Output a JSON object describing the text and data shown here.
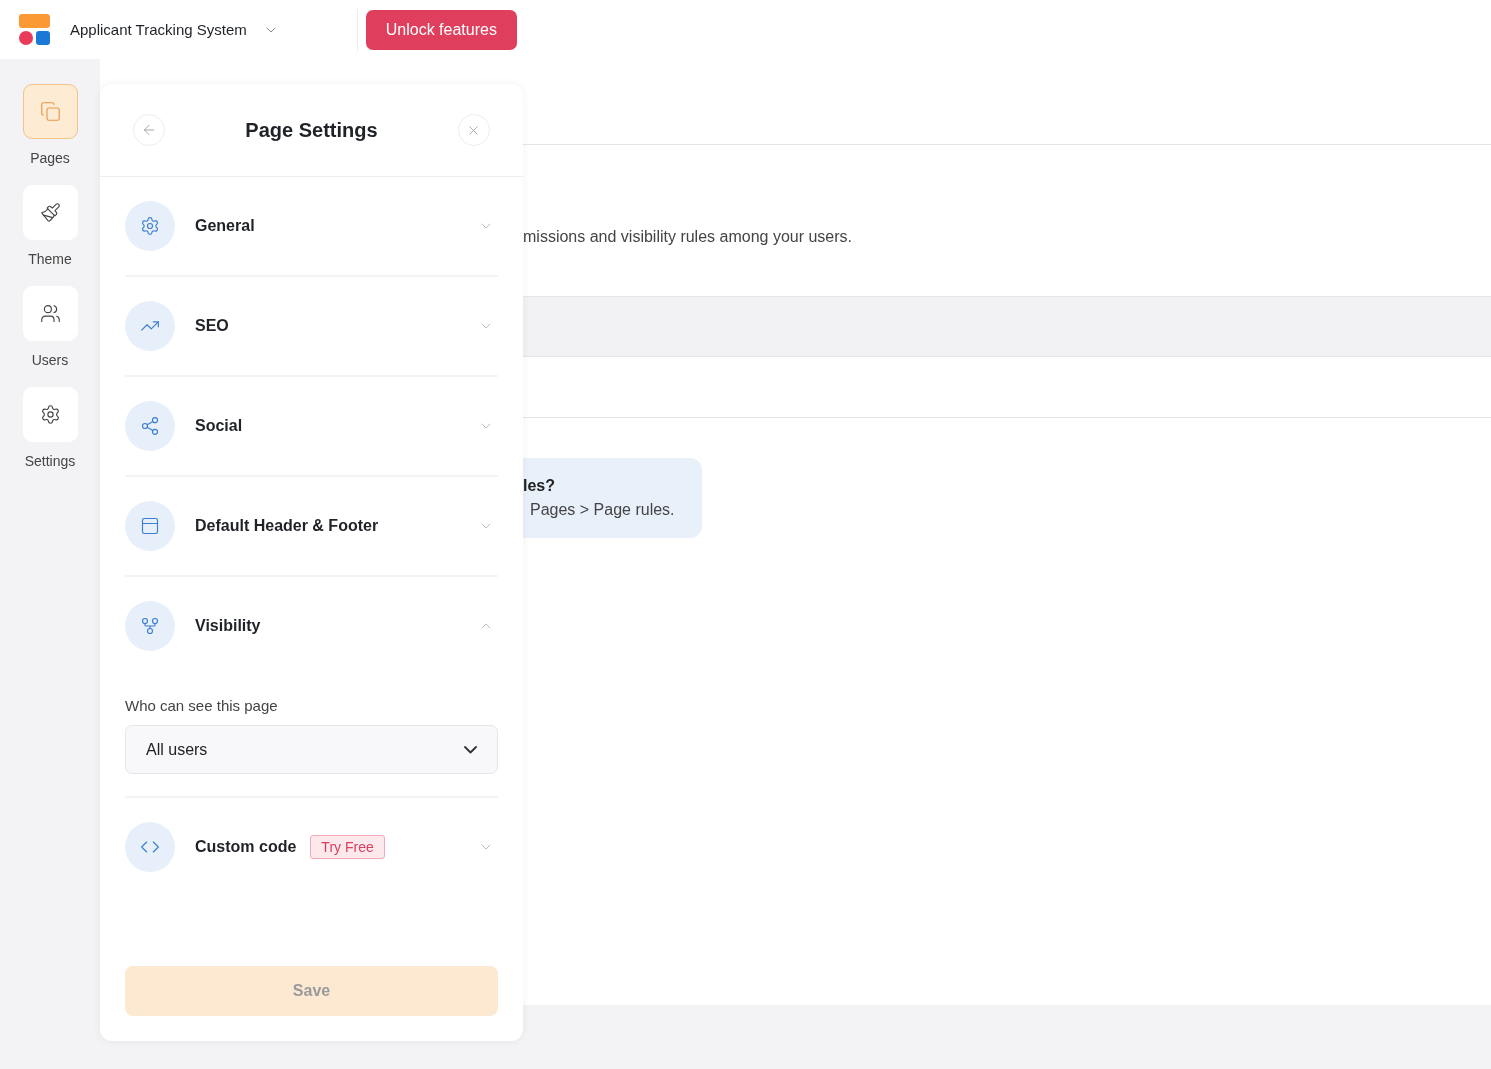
{
  "topbar": {
    "app_name": "Applicant Tracking System",
    "cta": "Unlock features"
  },
  "nav": [
    {
      "label": "Pages",
      "selected": true
    },
    {
      "label": "Theme",
      "selected": false
    },
    {
      "label": "Users",
      "selected": false
    },
    {
      "label": "Settings",
      "selected": false
    }
  ],
  "panel": {
    "title": "Page Settings",
    "sections": [
      {
        "title": "General",
        "expanded": false
      },
      {
        "title": "SEO",
        "expanded": false
      },
      {
        "title": "Social",
        "expanded": false
      },
      {
        "title": "Default Header & Footer",
        "expanded": false
      },
      {
        "title": "Visibility",
        "expanded": true,
        "field": {
          "label": "Who can see this page",
          "value": "All users"
        }
      },
      {
        "title": "Custom code",
        "expanded": false,
        "badge": "Try Free"
      }
    ],
    "save": {
      "label": "Save",
      "disabled": true
    }
  },
  "background": {
    "description": "missions and visibility rules among your users.",
    "info_title": "les?",
    "info_text": "Pages > Page rules."
  }
}
